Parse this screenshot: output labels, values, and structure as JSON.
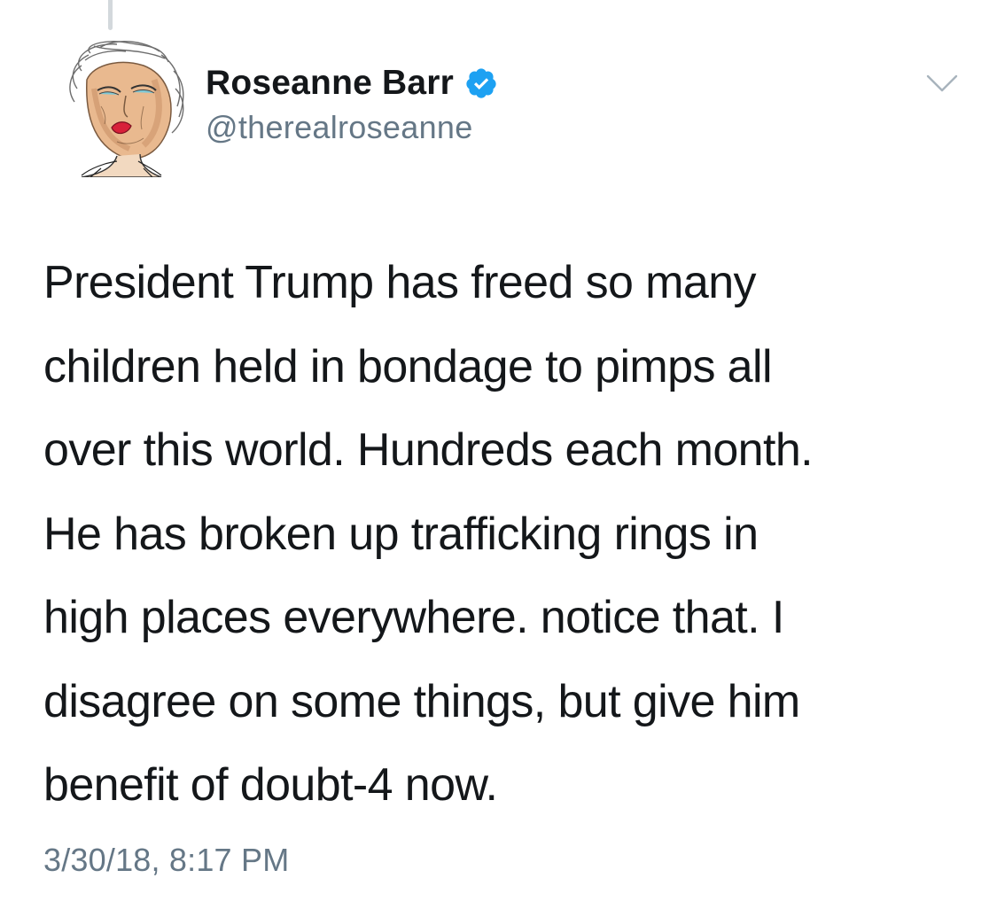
{
  "author": {
    "display_name": "Roseanne Barr",
    "handle": "@therealroseanne",
    "verified": true,
    "avatar_icon": "drawn-portrait-avatar"
  },
  "tweet": {
    "text": "President Trump has freed so many\nchildren held in bondage to pimps all\nover this world. Hundreds each month.\nHe has broken up trafficking rings in\nhigh places everywhere. notice that. I\ndisagree on some things, but give him\nbenefit of doubt-4 now.",
    "timestamp": "3/30/18, 8:17 PM"
  },
  "icons": {
    "verified": "verified-badge-icon",
    "menu": "chevron-down-icon"
  },
  "colors": {
    "text": "#14171a",
    "secondary": "#657786",
    "verified_blue": "#1da1f2",
    "thread_line": "#d3d8dc"
  }
}
